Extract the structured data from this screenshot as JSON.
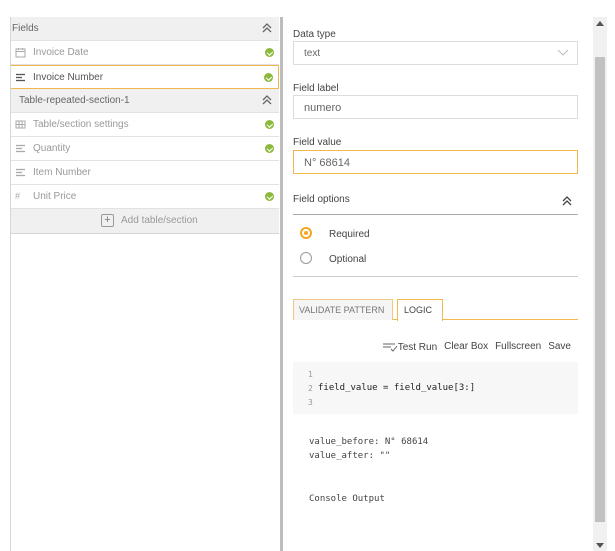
{
  "top_strip": {
    "text": "·· ··· ····· ·· ·· ·····"
  },
  "fields_panel": {
    "header": "Fields",
    "items": [
      {
        "label": "Invoice Date",
        "icon": "calendar-icon",
        "checked": true
      },
      {
        "label": "Invoice Number",
        "icon": "text-lines-icon",
        "checked": true,
        "active": true
      }
    ],
    "section": {
      "label": "Table-repeated-section-1",
      "items": [
        {
          "label": "Table/section settings",
          "icon": "table-icon",
          "checked": true
        },
        {
          "label": "Quantity",
          "icon": "text-lines-icon",
          "checked": true
        },
        {
          "label": "Item Number",
          "icon": "text-lines-icon",
          "checked": false
        },
        {
          "label": "Unit Price",
          "icon": "hash-icon",
          "checked": true
        }
      ]
    },
    "add_label": "Add table/section"
  },
  "details": {
    "data_type_label": "Data type",
    "data_type_value": "text",
    "field_label_label": "Field label",
    "field_label_value": "numero",
    "field_value_label": "Field value",
    "field_value_value": "N° 68614",
    "field_options_label": "Field options",
    "options": [
      {
        "label": "Required",
        "selected": true
      },
      {
        "label": "Optional",
        "selected": false
      }
    ],
    "tabs": [
      {
        "label": "VALIDATE PATTERN",
        "active": false
      },
      {
        "label": "LOGIC",
        "active": true
      }
    ],
    "toolbar": {
      "test_run": "Test Run",
      "clear_box": "Clear Box",
      "fullscreen": "Fullscreen",
      "save": "Save"
    },
    "editor": {
      "lines": [
        "1",
        "2",
        "3"
      ],
      "code": "field_value = field_value[3:]"
    },
    "console": {
      "value_before": "value_before: N° 68614",
      "value_after": "value_after: \"\"",
      "output_label": "Console Output"
    }
  },
  "colors": {
    "accent": "#f0b94d",
    "check_green": "#8bb93c",
    "radio_orange": "#f5a623"
  }
}
